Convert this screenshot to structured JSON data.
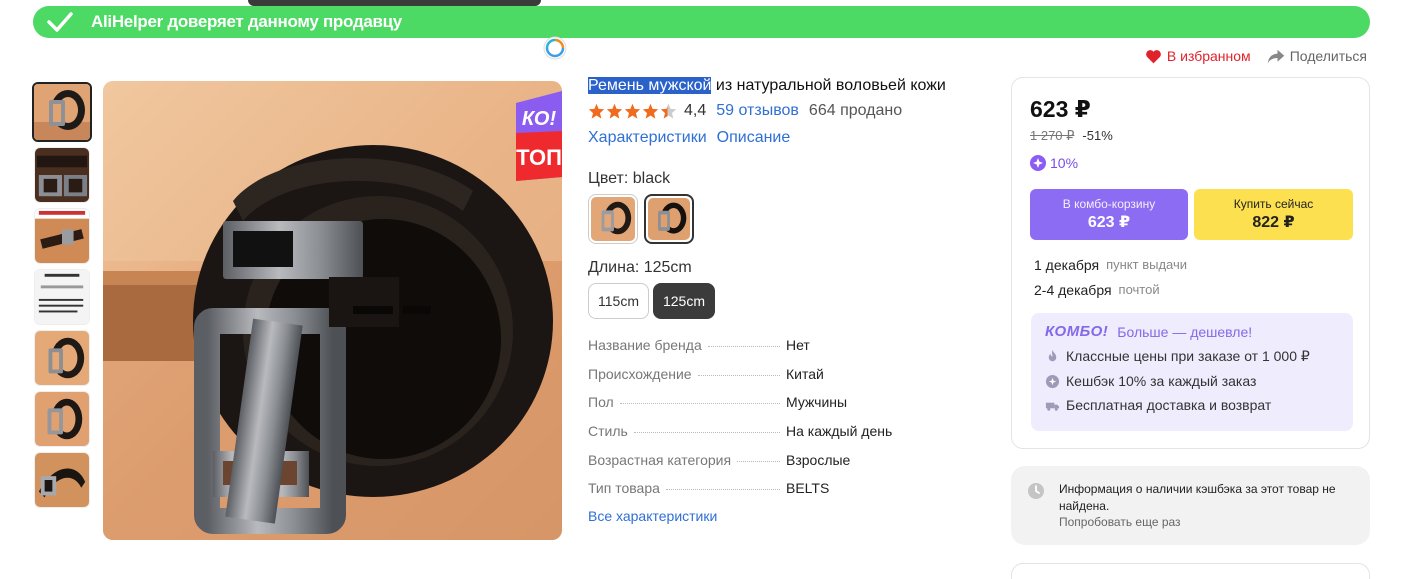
{
  "banner": {
    "text": "AliHelper доверяет данному продавцу",
    "color": "#4cd964"
  },
  "actions": {
    "favorite": "В избранном",
    "share": "Поделиться"
  },
  "product": {
    "title_highlight": "Ремень мужской",
    "title_rest": " из натуральной воловьей кожи",
    "rating": "4,4",
    "rating_value": 4.4,
    "reviews": "59 отзывов",
    "sold": "664 продано",
    "links": [
      "Характеристики",
      "Описание"
    ],
    "badge_top": "КО!",
    "badge_bottom": "ТОП"
  },
  "options": {
    "color_label": "Цвет: black",
    "length_label": "Длина: 125cm",
    "sizes": [
      "115cm",
      "125cm"
    ]
  },
  "specs": [
    {
      "k": "Название бренда",
      "v": "Нет"
    },
    {
      "k": "Происхождение",
      "v": "Китай"
    },
    {
      "k": "Пол",
      "v": "Мужчины"
    },
    {
      "k": "Стиль",
      "v": "На каждый день"
    },
    {
      "k": "Возрастная категория",
      "v": "Взрослые"
    },
    {
      "k": "Тип товара",
      "v": "BELTS"
    }
  ],
  "all_specs": "Все характеристики",
  "buy": {
    "price": "623 ₽",
    "old_price": "1 270 ₽",
    "discount": "-51%",
    "points": "10%",
    "combo_btn_l1": "В комбо-корзину",
    "combo_btn_l2": "623 ₽",
    "buy_btn_l1": "Купить сейчас",
    "buy_btn_l2": "822 ₽",
    "delivery": [
      {
        "date": "1 декабря",
        "method": "пункт выдачи"
      },
      {
        "date": "2-4 декабря",
        "method": "почтой"
      }
    ]
  },
  "combo": {
    "brand": "КОМБО!",
    "tagline": "Больше — дешевле!",
    "rows": [
      "Классные цены при заказе от 1 000 ₽",
      "Кешбэк 10% за каждый заказ",
      "Бесплатная доставка и возврат"
    ]
  },
  "cashback": {
    "text": "Информация о наличии кэшбэка за этот товар не найдена.",
    "retry": "Попробовать еще раз"
  },
  "colors": {
    "accent": "#2f6fd6",
    "brand_purple": "#8b6cf2",
    "buy_yellow": "#fde04f",
    "fav_red": "#e0232b"
  }
}
